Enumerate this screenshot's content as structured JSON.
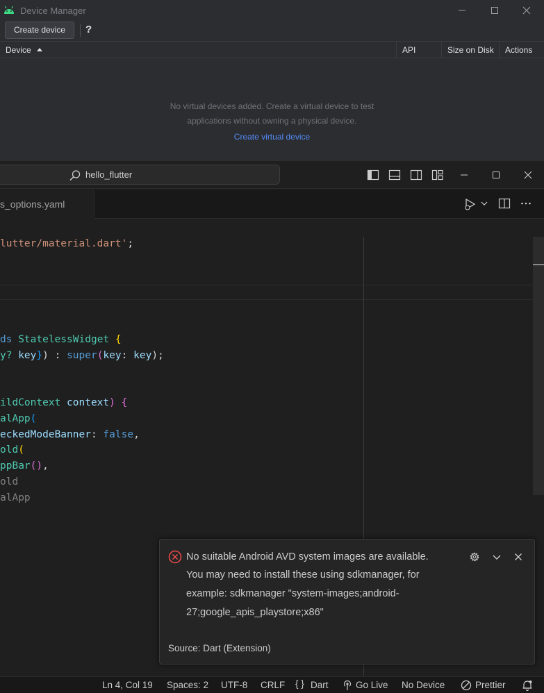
{
  "device_manager": {
    "title": "Device Manager",
    "create_device_label": "Create device",
    "help_label": "?",
    "columns": {
      "device": "Device",
      "api": "API",
      "size": "Size on Disk",
      "actions": "Actions"
    },
    "empty_line1": "No virtual devices added. Create a virtual device to test",
    "empty_line2": "applications without owning a physical device.",
    "empty_link": "Create virtual device"
  },
  "vscode": {
    "search_text": "hello_flutter",
    "tab_label": "s_options.yaml",
    "code": {
      "l1_str": "lutter/material.dart'",
      "l1_end": ";",
      "l2_kw": "ds ",
      "l2_type": "StatelessWidget ",
      "l2_brace": "{",
      "l3_a": "y? ",
      "l3_b": "key",
      "l3_c": "}",
      "l3_d": ") : ",
      "l3_e": "super",
      "l3_f": "(",
      "l3_g": "key",
      "l3_h": ": ",
      "l3_i": "key",
      "l3_j": ");",
      "l4_a": "ildContext ",
      "l4_b": "context",
      "l4_c": ") {",
      "l5_a": "alApp",
      "l5_b": "(",
      "l6_a": "eckedModeBanner",
      "l6_b": ": ",
      "l6_c": "false",
      "l6_d": ",",
      "l7_a": "old",
      "l7_b": "(",
      "l8_a": "ppBar",
      "l8_b": "()",
      "l8_c": ",",
      "l9": "old",
      "l10": "alApp"
    }
  },
  "notification": {
    "line1": "No suitable Android AVD system images are available.",
    "line2": "You may need to install these using sdkmanager, for",
    "line3": "example: sdkmanager \"system-images;android-",
    "line4": "27;google_apis_playstore;x86\"",
    "source": "Source: Dart (Extension)"
  },
  "status_bar": {
    "position": "Ln 4, Col 19",
    "spaces": "Spaces: 2",
    "encoding": "UTF-8",
    "eol": "CRLF",
    "language_icon": "{ }",
    "language": "Dart",
    "go_live": "Go Live",
    "device": "No Device",
    "prettier": "Prettier"
  },
  "colors": {
    "dm_bg": "#2b2d30",
    "dm_link": "#548af7",
    "vs_bg": "#1f1f1f",
    "error_red": "#f14c4c"
  },
  "icons": [
    "android-icon",
    "minimize-icon",
    "maximize-icon",
    "close-icon",
    "search-icon",
    "sort-asc-icon",
    "toggle-primary-sidebar-icon",
    "toggle-panel-icon",
    "toggle-secondary-sidebar-icon",
    "customize-layout-icon",
    "run-debug-icon",
    "split-editor-icon",
    "more-actions-icon",
    "error-icon",
    "gear-icon",
    "chevron-down-icon",
    "broadcast-icon",
    "prettier-icon",
    "bell-icon"
  ]
}
